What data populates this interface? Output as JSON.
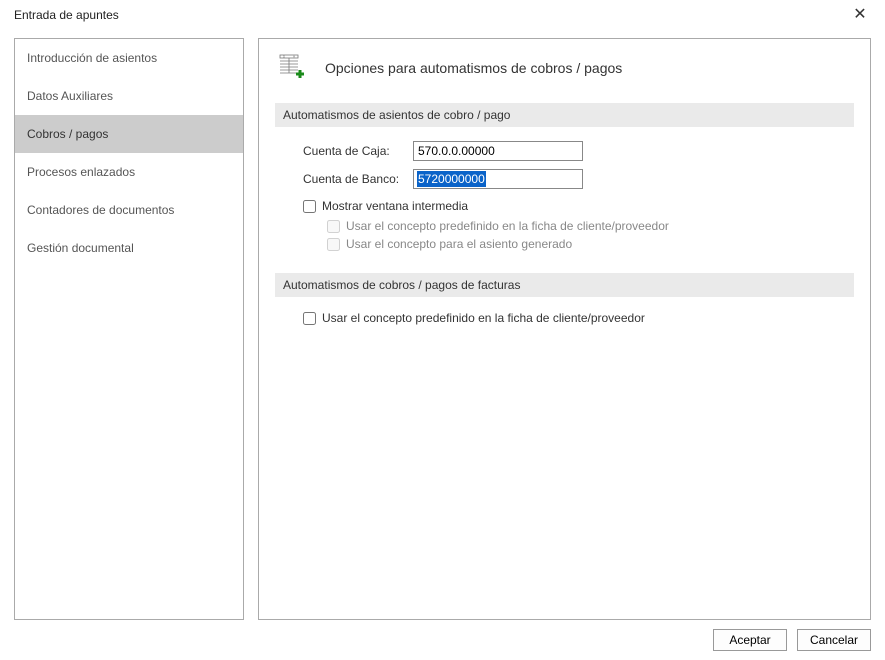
{
  "window": {
    "title": "Entrada de apuntes"
  },
  "sidebar": {
    "items": [
      {
        "label": "Introducción de asientos"
      },
      {
        "label": "Datos Auxiliares"
      },
      {
        "label": "Cobros / pagos"
      },
      {
        "label": "Procesos enlazados"
      },
      {
        "label": "Contadores de documentos"
      },
      {
        "label": "Gestión documental"
      }
    ],
    "selected_index": 2
  },
  "page": {
    "title": "Opciones para automatismos de cobros / pagos"
  },
  "section1": {
    "header": "Automatismos de asientos de cobro / pago",
    "cuenta_caja_label": "Cuenta de Caja:",
    "cuenta_caja_value": "570.0.0.00000",
    "cuenta_banco_label": "Cuenta de Banco:",
    "cuenta_banco_value": "5720000000",
    "mostrar_ventana": "Mostrar ventana intermedia",
    "sub1": "Usar el concepto predefinido en la ficha de cliente/proveedor",
    "sub2": "Usar el concepto para el asiento generado"
  },
  "section2": {
    "header": "Automatismos de cobros / pagos de facturas",
    "check1": "Usar el concepto predefinido en la ficha de cliente/proveedor"
  },
  "footer": {
    "accept": "Aceptar",
    "cancel": "Cancelar"
  }
}
